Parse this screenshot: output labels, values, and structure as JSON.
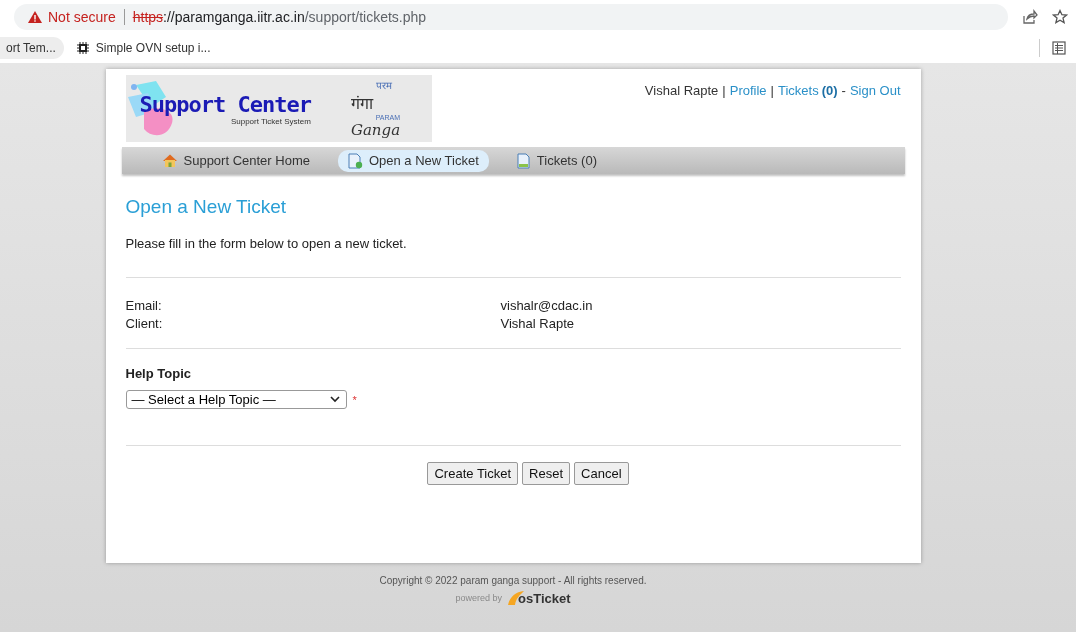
{
  "browser": {
    "security": "Not secure",
    "url_scheme": "https",
    "url_host": "://paramganga.iitr.ac.in",
    "url_path": "/support/tickets.php"
  },
  "bookmarks": [
    {
      "label": "ort Tem...",
      "kind": "plain"
    },
    {
      "label": "Simple OVN setup i...",
      "kind": "chip"
    }
  ],
  "header": {
    "logo": {
      "title": "Support Center",
      "subtitle": "Support Ticket System",
      "hindi_top": "परम",
      "hindi_main": "गंगा",
      "latin_small": "PARAM",
      "latin_main": "Ganga"
    },
    "user_links": [
      {
        "text": "Vishal Rapte",
        "kind": "text"
      },
      {
        "text": "|",
        "kind": "sep"
      },
      {
        "text": "Profile",
        "kind": "link"
      },
      {
        "text": "|",
        "kind": "sep"
      },
      {
        "text": "Tickets",
        "kind": "link"
      },
      {
        "text": "(0)",
        "kind": "count"
      },
      {
        "text": "-",
        "kind": "sep"
      },
      {
        "text": "Sign Out",
        "kind": "link"
      }
    ]
  },
  "nav": [
    {
      "label": "Support Center Home",
      "kind": "home",
      "selected": false
    },
    {
      "label": "Open a New Ticket",
      "kind": "new",
      "selected": true
    },
    {
      "label": "Tickets (0)",
      "kind": "list",
      "selected": false
    }
  ],
  "title": "Open a New Ticket",
  "intro": "Please fill in the form below to open a new ticket.",
  "info": [
    {
      "label": "Email:",
      "value": "vishalr@cdac.in"
    },
    {
      "label": "Client:",
      "value": "Vishal Rapte"
    }
  ],
  "help_topic": {
    "label": "Help Topic",
    "value": "— Select a Help Topic —",
    "required_mark": "*"
  },
  "buttons": [
    "Create Ticket",
    "Reset",
    "Cancel"
  ],
  "footer": {
    "copyright": "Copyright © 2022 param ganga support - All rights reserved.",
    "powered_by": "powered by",
    "brand": "osTicket"
  }
}
